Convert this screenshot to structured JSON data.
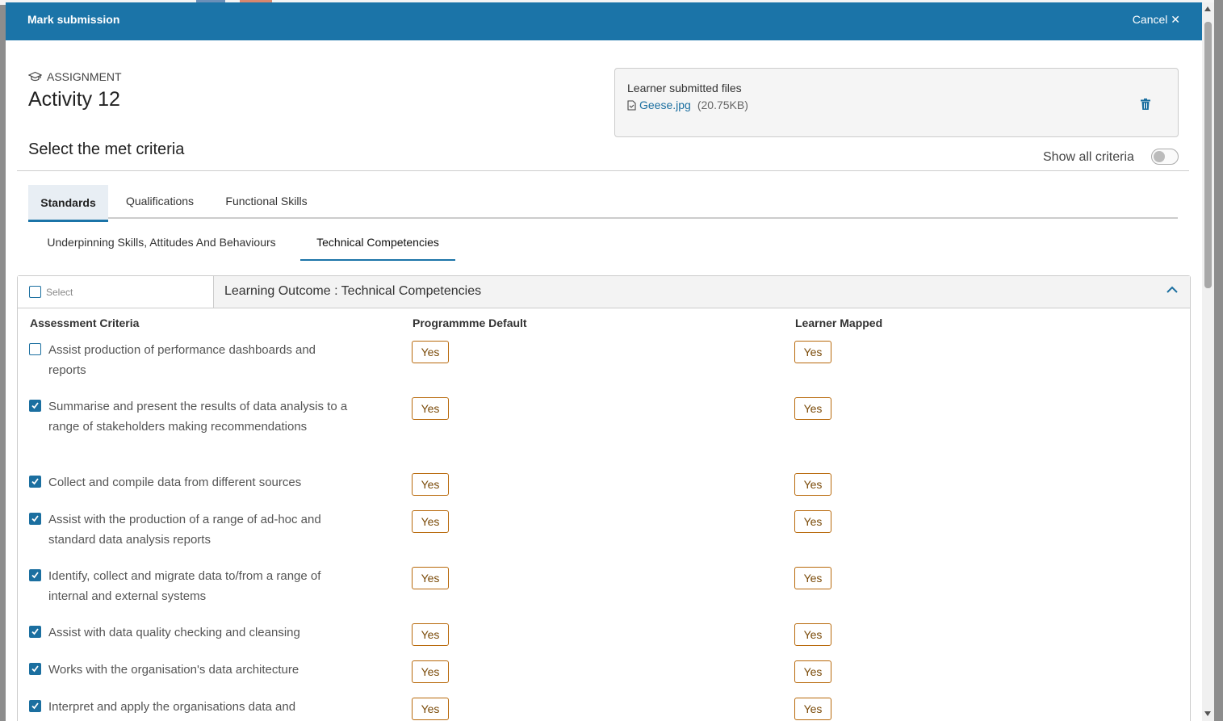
{
  "modal": {
    "title": "Mark submission",
    "cancel_label": "Cancel ✕"
  },
  "assignment": {
    "label": "ASSIGNMENT",
    "title": "Activity 12",
    "select_heading": "Select the met criteria"
  },
  "files": {
    "label": "Learner submitted files",
    "file_name": "Geese.jpg",
    "file_size": "(20.75KB)"
  },
  "show_all": {
    "label": "Show all criteria",
    "enabled": false
  },
  "tabs": [
    "Standards",
    "Qualifications",
    "Functional Skills"
  ],
  "subtabs": [
    "Underpinning Skills, Attitudes And Behaviours",
    "Technical Competencies"
  ],
  "learning_outcome": {
    "select_label": "Select",
    "title": "Learning Outcome : Technical Competencies"
  },
  "columns": {
    "criteria": "Assessment Criteria",
    "default": "Programmme Default",
    "mapped": "Learner Mapped"
  },
  "criteria": [
    {
      "text": "Assist production of performance dashboards and reports",
      "checked": false,
      "default": "Yes",
      "mapped": "Yes"
    },
    {
      "text": "Summarise and present the results of data analysis to a range of stakeholders making recommendations",
      "checked": true,
      "default": "Yes",
      "mapped": "Yes"
    },
    {
      "text": "Collect and compile data from different sources",
      "checked": true,
      "default": "Yes",
      "mapped": "Yes"
    },
    {
      "text": "Assist with the production of a range of ad-hoc and standard data analysis reports",
      "checked": true,
      "default": "Yes",
      "mapped": "Yes"
    },
    {
      "text": "Identify, collect and migrate data to/from a range of internal and external systems",
      "checked": true,
      "default": "Yes",
      "mapped": "Yes"
    },
    {
      "text": "Assist with data quality checking and cleansing",
      "checked": true,
      "default": "Yes",
      "mapped": "Yes"
    },
    {
      "text": "Works with the organisation's data architecture",
      "checked": true,
      "default": "Yes",
      "mapped": "Yes"
    },
    {
      "text": "Interpret and apply the organisations data and",
      "checked": true,
      "default": "Yes",
      "mapped": "Yes"
    }
  ]
}
